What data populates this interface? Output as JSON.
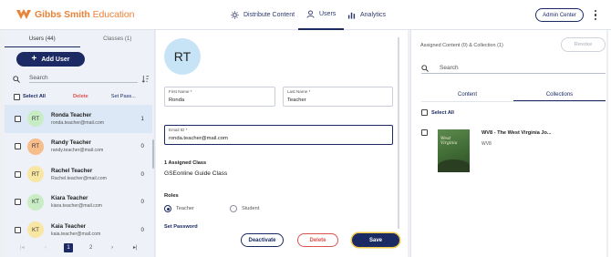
{
  "header": {
    "brand_bold": "Gibbs Smith",
    "brand_light": " Education",
    "nav": [
      {
        "label": "Distribute Content",
        "icon": "sun-icon"
      },
      {
        "label": "Users",
        "icon": "user-icon"
      },
      {
        "label": "Analytics",
        "icon": "bar-chart-icon"
      }
    ],
    "active_nav": "Users",
    "admin_button": "Admin Center"
  },
  "left": {
    "tabs": [
      "Users (44)",
      "Classes (1)"
    ],
    "add_user": "Add User",
    "search_placeholder": "Search",
    "select_all": "Select All",
    "delete": "Delete",
    "set_password": "Set Pass...",
    "users": [
      {
        "initials": "RT",
        "name": "Ronda Teacher",
        "email": "ronda.teacher@mail.com",
        "count": "1",
        "avatar": "#c8ecc4",
        "selected": true
      },
      {
        "initials": "RT",
        "name": "Randy Teacher",
        "email": "randy.teacher@mail.com",
        "count": "0",
        "avatar": "#f7bd8a",
        "selected": false
      },
      {
        "initials": "RT",
        "name": "Rachel Teacher",
        "email": "Rachel.teacher@mail.com",
        "count": "0",
        "avatar": "#f8e6a3",
        "selected": false
      },
      {
        "initials": "KT",
        "name": "Kiara Teacher",
        "email": "kiara.teacher@mail.com",
        "count": "0",
        "avatar": "#c8ecc4",
        "selected": false
      },
      {
        "initials": "KT",
        "name": "Kaia Teacher",
        "email": "kaia.teacher@mail.com",
        "count": "0",
        "avatar": "#f8e6a3",
        "selected": false
      }
    ],
    "pager": {
      "first": "|◂",
      "prev": "‹",
      "page1": "1",
      "page2": "2",
      "next": "›",
      "last": "▸|"
    }
  },
  "detail": {
    "initials": "RT",
    "first_name_label": "First Name *",
    "first_name": "Ronda",
    "last_name_label": "Last Name *",
    "last_name": "Teacher",
    "email_label": "Email ID *",
    "email": "ronda.teacher@mail.com",
    "assigned_class_label": "1 Assigned Class",
    "assigned_class": "GSEonline Guide Class",
    "roles_label": "Roles",
    "role_teacher": "Teacher",
    "role_student": "Student",
    "selected_role": "Teacher",
    "set_password": "Set Password",
    "deactivate": "Deactivate",
    "delete": "Delete",
    "save": "Save"
  },
  "right": {
    "heading": "Assigned Content (0) & Collection (1)",
    "revoke": "Revoke",
    "search_placeholder": "Search",
    "tabs": [
      "Content",
      "Collections"
    ],
    "active_tab": "Collections",
    "select_all": "Select All",
    "item": {
      "cover_text": "West Virginia",
      "title": "WV8 - The West Virginia Jo...",
      "code": "WV8"
    }
  },
  "colors": {
    "brand_orange": "#e8833a",
    "navy": "#1b2a63",
    "delete_red": "#d9534f",
    "save_ring": "#f2c94c"
  }
}
